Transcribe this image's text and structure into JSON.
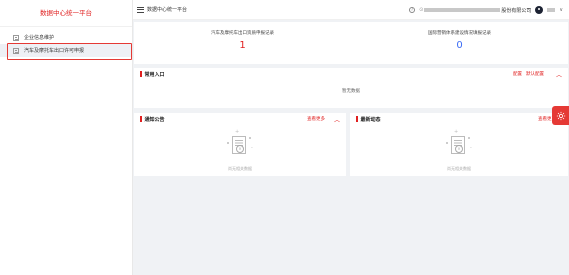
{
  "sidebar": {
    "title": "数据中心统一平台",
    "items": [
      {
        "label": "企业信息维护",
        "active": false
      },
      {
        "label": "汽车及摩托车出口许可申报",
        "active": true
      }
    ]
  },
  "header": {
    "title": "数据中心统一平台",
    "company_suffix": "股份有限公司"
  },
  "stats": [
    {
      "label": "汽车及摩托车出口资质申报记录",
      "value": "1"
    },
    {
      "label": "国际营销体系建设情况填报记录",
      "value": "0"
    }
  ],
  "quick_entry": {
    "title": "常用入口",
    "config_label": "配置",
    "default_config_label": "默认配置",
    "empty_text": "暂无数据"
  },
  "notice": {
    "title": "通知公告",
    "more_label": "查看更多",
    "empty_text": "尚无相关数据"
  },
  "news": {
    "title": "最新动态",
    "more_label": "查看更多",
    "empty_text": "尚无相关数据"
  },
  "colors": {
    "accent": "#e02020",
    "value_blue": "#3b6cf5"
  },
  "icons": [
    "menu-icon",
    "help-icon",
    "avatar-icon",
    "chevron-down-icon",
    "chevron-up-icon",
    "empty-search-icon",
    "gear-icon"
  ]
}
